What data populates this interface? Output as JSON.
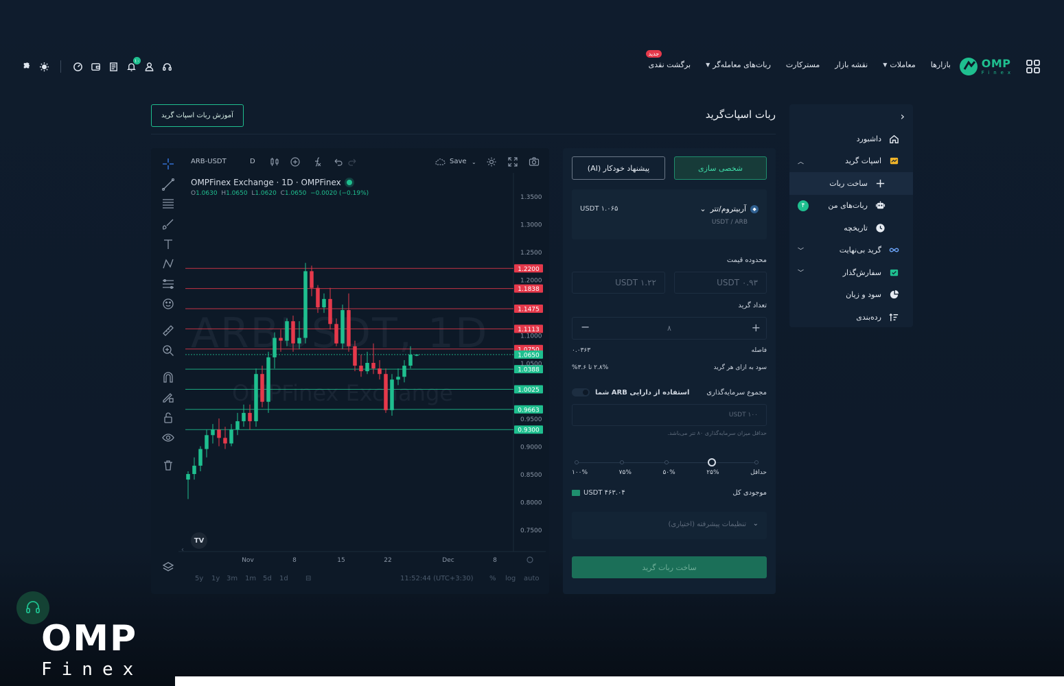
{
  "topbar": {
    "nav": [
      {
        "label": "بازارها",
        "caret": false
      },
      {
        "label": "معاملات",
        "caret": true
      },
      {
        "label": "نقشه بازار",
        "caret": false
      },
      {
        "label": "مسترکارت",
        "caret": false
      },
      {
        "label": "ربات‌های معامله‌گر",
        "caret": true
      },
      {
        "label": "برگشت نقدی",
        "caret": false,
        "badge": "جدید"
      }
    ],
    "brand": {
      "name": "OMP",
      "sub": "Finex"
    },
    "bell_count": "۱۰",
    "left_icons": [
      "puzzle-icon",
      "sun-icon",
      "chart-circle-icon",
      "wallet-icon",
      "receipt-icon",
      "bell-icon",
      "user-icon",
      "headset-icon"
    ]
  },
  "sidebar": {
    "items": [
      {
        "label": "داشبورد",
        "icon": "home-icon"
      },
      {
        "label": "اسپات گرید",
        "icon": "grid-bot-icon",
        "chevron": "^"
      },
      {
        "label": "ساخت ربات",
        "icon": "plus-icon",
        "active": true
      },
      {
        "label": "ربات‌های من",
        "icon": "robot-icon",
        "count": "۴"
      },
      {
        "label": "تاریخچه",
        "icon": "clock-icon"
      },
      {
        "label": "گرید بی‌نهایت",
        "icon": "infinity-icon",
        "chevron": "v"
      },
      {
        "label": "سفارش‌گذار",
        "icon": "order-icon",
        "chevron": "v"
      },
      {
        "label": "سود و زیان",
        "icon": "pie-icon"
      },
      {
        "label": "رده‌بندی",
        "icon": "ranking-icon"
      }
    ]
  },
  "page": {
    "title": "ربات اسپات‌گرید",
    "tutorial": "آموزش ربات اسپات گرید"
  },
  "chart": {
    "symbol": "ARB-USDT",
    "interval": "D",
    "save": "Save",
    "legend_title": "OMPFinex Exchange · 1D · OMPFinex",
    "ohlc": {
      "o": "1.0630",
      "h": "1.0650",
      "l": "1.0620",
      "c": "1.0650",
      "chg": "−0.0020 (−0.19%)"
    },
    "watermark1": "ARBUSDT, 1D",
    "watermark2": "OMPFinex Exchange",
    "tv": "TV",
    "y_ticks": [
      "1.3500",
      "1.3000",
      "1.2500",
      "1.2000",
      "1.1000",
      "1.0500",
      "0.9500",
      "0.9000",
      "0.8500",
      "0.8000",
      "0.7500"
    ],
    "grid_lines": [
      {
        "price": "1.2200",
        "color": "#e5394b"
      },
      {
        "price": "1.1838",
        "color": "#e5394b"
      },
      {
        "price": "1.1475",
        "color": "#e5394b"
      },
      {
        "price": "1.1113",
        "color": "#e5394b"
      },
      {
        "price": "1.0750",
        "color": "#e5394b"
      },
      {
        "price": "1.0650",
        "color": "#1fbf8f"
      },
      {
        "price": "1.0388",
        "color": "#1fbf8f"
      },
      {
        "price": "1.0025",
        "color": "#1fbf8f"
      },
      {
        "price": "0.9663",
        "color": "#1fbf8f"
      },
      {
        "price": "0.9300",
        "color": "#1fbf8f"
      }
    ],
    "x_ticks": [
      "Nov",
      "8",
      "15",
      "22",
      "Dec",
      "8"
    ],
    "ranges": [
      "5y",
      "1y",
      "3m",
      "1m",
      "5d",
      "1d"
    ],
    "time": "11:52:44 (UTC+3:30)",
    "bottom_right": [
      "%",
      "log",
      "auto"
    ]
  },
  "chart_data": {
    "type": "candlestick",
    "up_color": "#1fbf8f",
    "down_color": "#e5394b",
    "ylim": [
      0.72,
      1.38
    ],
    "candles": [
      {
        "o": 0.84,
        "h": 0.855,
        "l": 0.805,
        "c": 0.85
      },
      {
        "o": 0.85,
        "h": 0.88,
        "l": 0.84,
        "c": 0.865
      },
      {
        "o": 0.865,
        "h": 0.9,
        "l": 0.855,
        "c": 0.895
      },
      {
        "o": 0.895,
        "h": 0.93,
        "l": 0.88,
        "c": 0.92
      },
      {
        "o": 0.92,
        "h": 0.94,
        "l": 0.905,
        "c": 0.93
      },
      {
        "o": 0.93,
        "h": 0.95,
        "l": 0.9,
        "c": 0.915
      },
      {
        "o": 0.915,
        "h": 0.935,
        "l": 0.895,
        "c": 0.905
      },
      {
        "o": 0.905,
        "h": 0.94,
        "l": 0.9,
        "c": 0.93
      },
      {
        "o": 0.93,
        "h": 0.96,
        "l": 0.92,
        "c": 0.945
      },
      {
        "o": 0.945,
        "h": 0.975,
        "l": 0.935,
        "c": 0.96
      },
      {
        "o": 0.96,
        "h": 0.975,
        "l": 0.93,
        "c": 0.945
      },
      {
        "o": 0.945,
        "h": 1.04,
        "l": 0.935,
        "c": 1.03
      },
      {
        "o": 1.03,
        "h": 1.045,
        "l": 0.97,
        "c": 0.98
      },
      {
        "o": 0.98,
        "h": 1.07,
        "l": 0.96,
        "c": 1.06
      },
      {
        "o": 1.06,
        "h": 1.105,
        "l": 1.04,
        "c": 1.095
      },
      {
        "o": 1.095,
        "h": 1.11,
        "l": 1.07,
        "c": 1.09
      },
      {
        "o": 1.09,
        "h": 1.13,
        "l": 1.08,
        "c": 1.125
      },
      {
        "o": 1.125,
        "h": 1.135,
        "l": 1.07,
        "c": 1.085
      },
      {
        "o": 1.085,
        "h": 1.125,
        "l": 1.075,
        "c": 1.095
      },
      {
        "o": 1.095,
        "h": 1.23,
        "l": 1.085,
        "c": 1.215
      },
      {
        "o": 1.215,
        "h": 1.225,
        "l": 1.17,
        "c": 1.185
      },
      {
        "o": 1.185,
        "h": 1.19,
        "l": 1.14,
        "c": 1.15
      },
      {
        "o": 1.15,
        "h": 1.175,
        "l": 1.14,
        "c": 1.165
      },
      {
        "o": 1.165,
        "h": 1.185,
        "l": 1.11,
        "c": 1.12
      },
      {
        "o": 1.12,
        "h": 1.13,
        "l": 1.08,
        "c": 1.085
      },
      {
        "o": 1.085,
        "h": 1.155,
        "l": 1.075,
        "c": 1.145
      },
      {
        "o": 1.145,
        "h": 1.175,
        "l": 1.07,
        "c": 1.08
      },
      {
        "o": 1.08,
        "h": 1.09,
        "l": 1.035,
        "c": 1.045
      },
      {
        "o": 1.045,
        "h": 1.065,
        "l": 1.025,
        "c": 1.035
      },
      {
        "o": 1.035,
        "h": 1.07,
        "l": 1.03,
        "c": 1.05
      },
      {
        "o": 1.05,
        "h": 1.085,
        "l": 1.03,
        "c": 1.04
      },
      {
        "o": 1.04,
        "h": 1.055,
        "l": 1.02,
        "c": 1.03
      },
      {
        "o": 1.03,
        "h": 1.04,
        "l": 0.96,
        "c": 0.965
      },
      {
        "o": 0.965,
        "h": 1.03,
        "l": 0.955,
        "c": 1.02
      },
      {
        "o": 1.02,
        "h": 1.04,
        "l": 1.01,
        "c": 1.025
      },
      {
        "o": 1.025,
        "h": 1.055,
        "l": 1.015,
        "c": 1.045
      },
      {
        "o": 1.045,
        "h": 1.08,
        "l": 1.04,
        "c": 1.065
      },
      {
        "o": 1.063,
        "h": 1.065,
        "l": 1.062,
        "c": 1.065
      }
    ]
  },
  "form": {
    "tab_personal": "شخصی سازی",
    "tab_ai": "پیشنهاد خودکار (AI)",
    "pair_name": "آربیتروم/تتر",
    "pair_caret": "⌄",
    "pair_sub": "USDT / ARB",
    "pair_icon": "arb-icon",
    "pair_price": "۱.۰۶۵ USDT",
    "price_range_label": "محدوده قیمت",
    "price_min": "USDT ۰.۹۳",
    "price_max": "USDT ۱.۲۲",
    "grid_count_label": "تعداد گرید",
    "grid_count": "۸",
    "spacing_label": "فاصله",
    "spacing_value": "۰.۰۳۶۳",
    "profit_label": "سود به ازای هر گرید",
    "profit_value": "۲.۸% تا ۳.۶%",
    "investment_label": "مجموع سرمایه‌گذاری",
    "use_asset_label": "استفاده از دارایی ARB شما",
    "investment_placeholder": "۱۰۰    USDT",
    "hint": "حداقل میزان سرمایه‌گذاری ۸۰ تتر می‌باشد.",
    "slider_level": 0.25,
    "slider_labels": [
      "حداقل",
      "۲۵%",
      "۵۰%",
      "۷۵%",
      "۱۰۰%"
    ],
    "balance_label": "موجودی کل",
    "balance_value": "۴۶۳.۰۴ USDT",
    "advanced_label": "تنظیمات پیشرفته (اختیاری)",
    "submit": "ساخت ربات گرید"
  },
  "footer": {
    "wm_omp": "OMP",
    "wm_finex": "Finex"
  }
}
